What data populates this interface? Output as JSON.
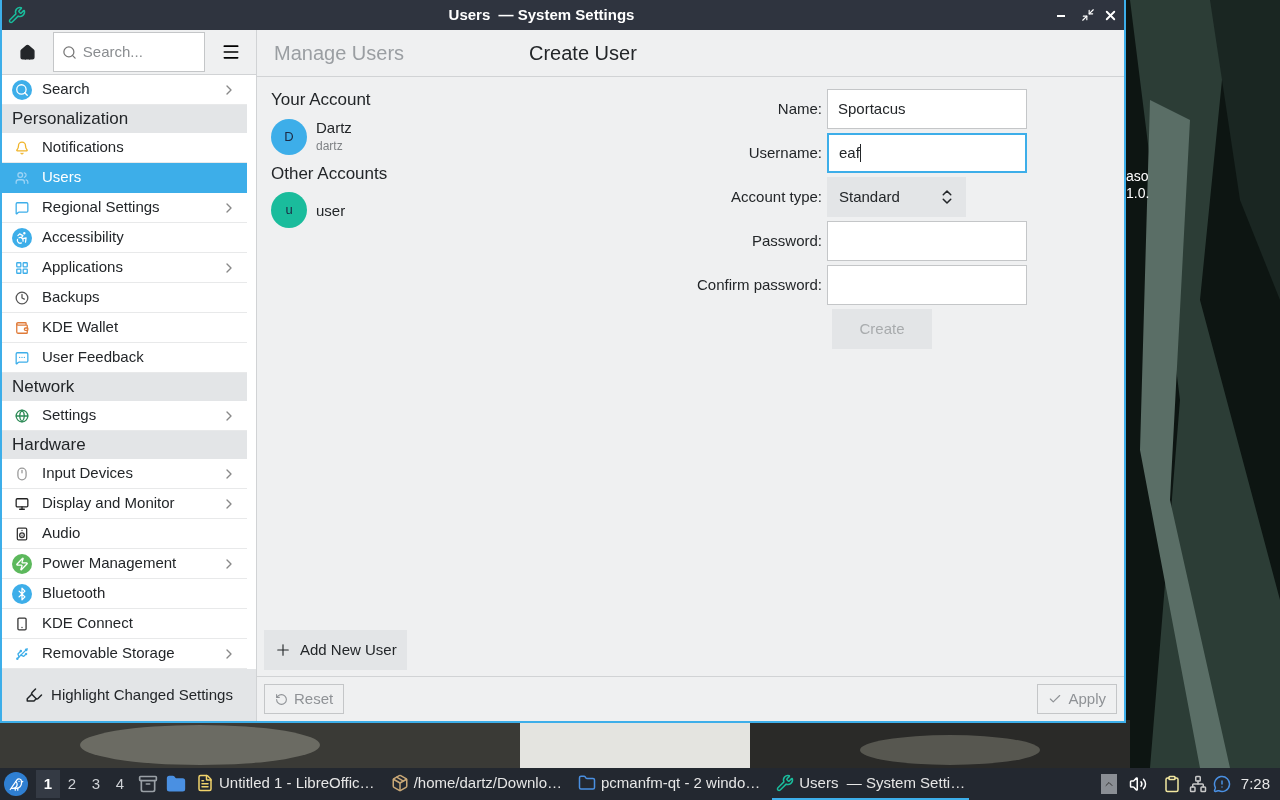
{
  "window": {
    "title": "Users  — System Settings"
  },
  "toolbar": {
    "search_placeholder": "Search..."
  },
  "sidebar": {
    "items": [
      {
        "kind": "item",
        "label": "Search",
        "expandable": true,
        "selected": false
      },
      {
        "kind": "section",
        "label": "Personalization"
      },
      {
        "kind": "item",
        "label": "Notifications",
        "expandable": false,
        "selected": false
      },
      {
        "kind": "item",
        "label": "Users",
        "expandable": false,
        "selected": true
      },
      {
        "kind": "item",
        "label": "Regional Settings",
        "expandable": true,
        "selected": false
      },
      {
        "kind": "item",
        "label": "Accessibility",
        "expandable": false,
        "selected": false
      },
      {
        "kind": "item",
        "label": "Applications",
        "expandable": true,
        "selected": false
      },
      {
        "kind": "item",
        "label": "Backups",
        "expandable": false,
        "selected": false
      },
      {
        "kind": "item",
        "label": "KDE Wallet",
        "expandable": false,
        "selected": false
      },
      {
        "kind": "item",
        "label": "User Feedback",
        "expandable": false,
        "selected": false
      },
      {
        "kind": "section",
        "label": "Network"
      },
      {
        "kind": "item",
        "label": "Settings",
        "expandable": true,
        "selected": false
      },
      {
        "kind": "section",
        "label": "Hardware"
      },
      {
        "kind": "item",
        "label": "Input Devices",
        "expandable": true,
        "selected": false
      },
      {
        "kind": "item",
        "label": "Display and Monitor",
        "expandable": true,
        "selected": false
      },
      {
        "kind": "item",
        "label": "Audio",
        "expandable": false,
        "selected": false
      },
      {
        "kind": "item",
        "label": "Power Management",
        "expandable": true,
        "selected": false
      },
      {
        "kind": "item",
        "label": "Bluetooth",
        "expandable": false,
        "selected": false
      },
      {
        "kind": "item",
        "label": "KDE Connect",
        "expandable": false,
        "selected": false
      },
      {
        "kind": "item",
        "label": "Removable Storage",
        "expandable": true,
        "selected": false
      }
    ],
    "footer_button": "Highlight Changed Settings"
  },
  "breadcrumb": [
    {
      "label": "Manage Users",
      "selected": false
    },
    {
      "label": "Create User",
      "selected": true
    }
  ],
  "accounts": [
    {
      "heading": "Your Account",
      "users": [
        {
          "initial": "D",
          "name": "Dartz",
          "username": "dartz",
          "color": "#3daee9"
        }
      ]
    },
    {
      "heading": "Other Accounts",
      "users": [
        {
          "initial": "u",
          "name": "user",
          "color": "#1abc9c"
        }
      ]
    }
  ],
  "form": {
    "fields": [
      {
        "kind": "text",
        "label": "Name:",
        "value": "Sportacus"
      },
      {
        "kind": "text",
        "label": "Username:",
        "value": "eaf",
        "focused": true
      },
      {
        "kind": "select",
        "label": "Account type:",
        "value": "Standard"
      },
      {
        "kind": "password",
        "label": "Password:"
      },
      {
        "kind": "password",
        "label": "Confirm password:"
      }
    ],
    "submit": {
      "label": "Create",
      "disabled": true
    }
  },
  "add_user_button": "Add New User",
  "reset_button": {
    "label": "Reset",
    "disabled": true
  },
  "apply_button": {
    "label": "Apply",
    "disabled": true
  },
  "desktop_labels": [
    "aso",
    "1.0."
  ],
  "taskbar": {
    "workspaces": [
      {
        "label": "1",
        "selected": true
      },
      {
        "label": "2",
        "selected": false
      },
      {
        "label": "3",
        "selected": false
      },
      {
        "label": "4",
        "selected": false
      }
    ],
    "tasks": [
      {
        "label": "Untitled 1 - LibreOffic…",
        "selected": false
      },
      {
        "label": "/home/dartz/Downlo…",
        "selected": false
      },
      {
        "label": "pcmanfm-qt - 2 windo…",
        "selected": false
      },
      {
        "label": "Users  — System Setti…",
        "selected": true
      }
    ],
    "clock": "7:28"
  }
}
